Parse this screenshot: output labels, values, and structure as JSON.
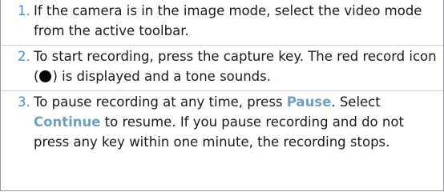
{
  "steps": [
    {
      "number": "1.",
      "text": "If the camera is in the image mode, select the video mode from the active toolbar."
    },
    {
      "number": "2.",
      "text_before": "To start recording, press the capture key. The red record icon (",
      "icon": "record-icon",
      "text_after": ") is displayed and a tone sounds."
    },
    {
      "number": "3.",
      "text_1": "To pause recording at any time, press ",
      "keyword_pause": "Pause",
      "text_2": ". Select ",
      "keyword_continue": "Continue",
      "text_3": " to resume. If you pause recording and do not press any key within one minute, the recording stops."
    }
  ],
  "colors": {
    "step_number": "#3d8fdc",
    "keyword": "#6fa0c4",
    "border": "#8c9ba8",
    "divider": "#c9d1d8"
  }
}
